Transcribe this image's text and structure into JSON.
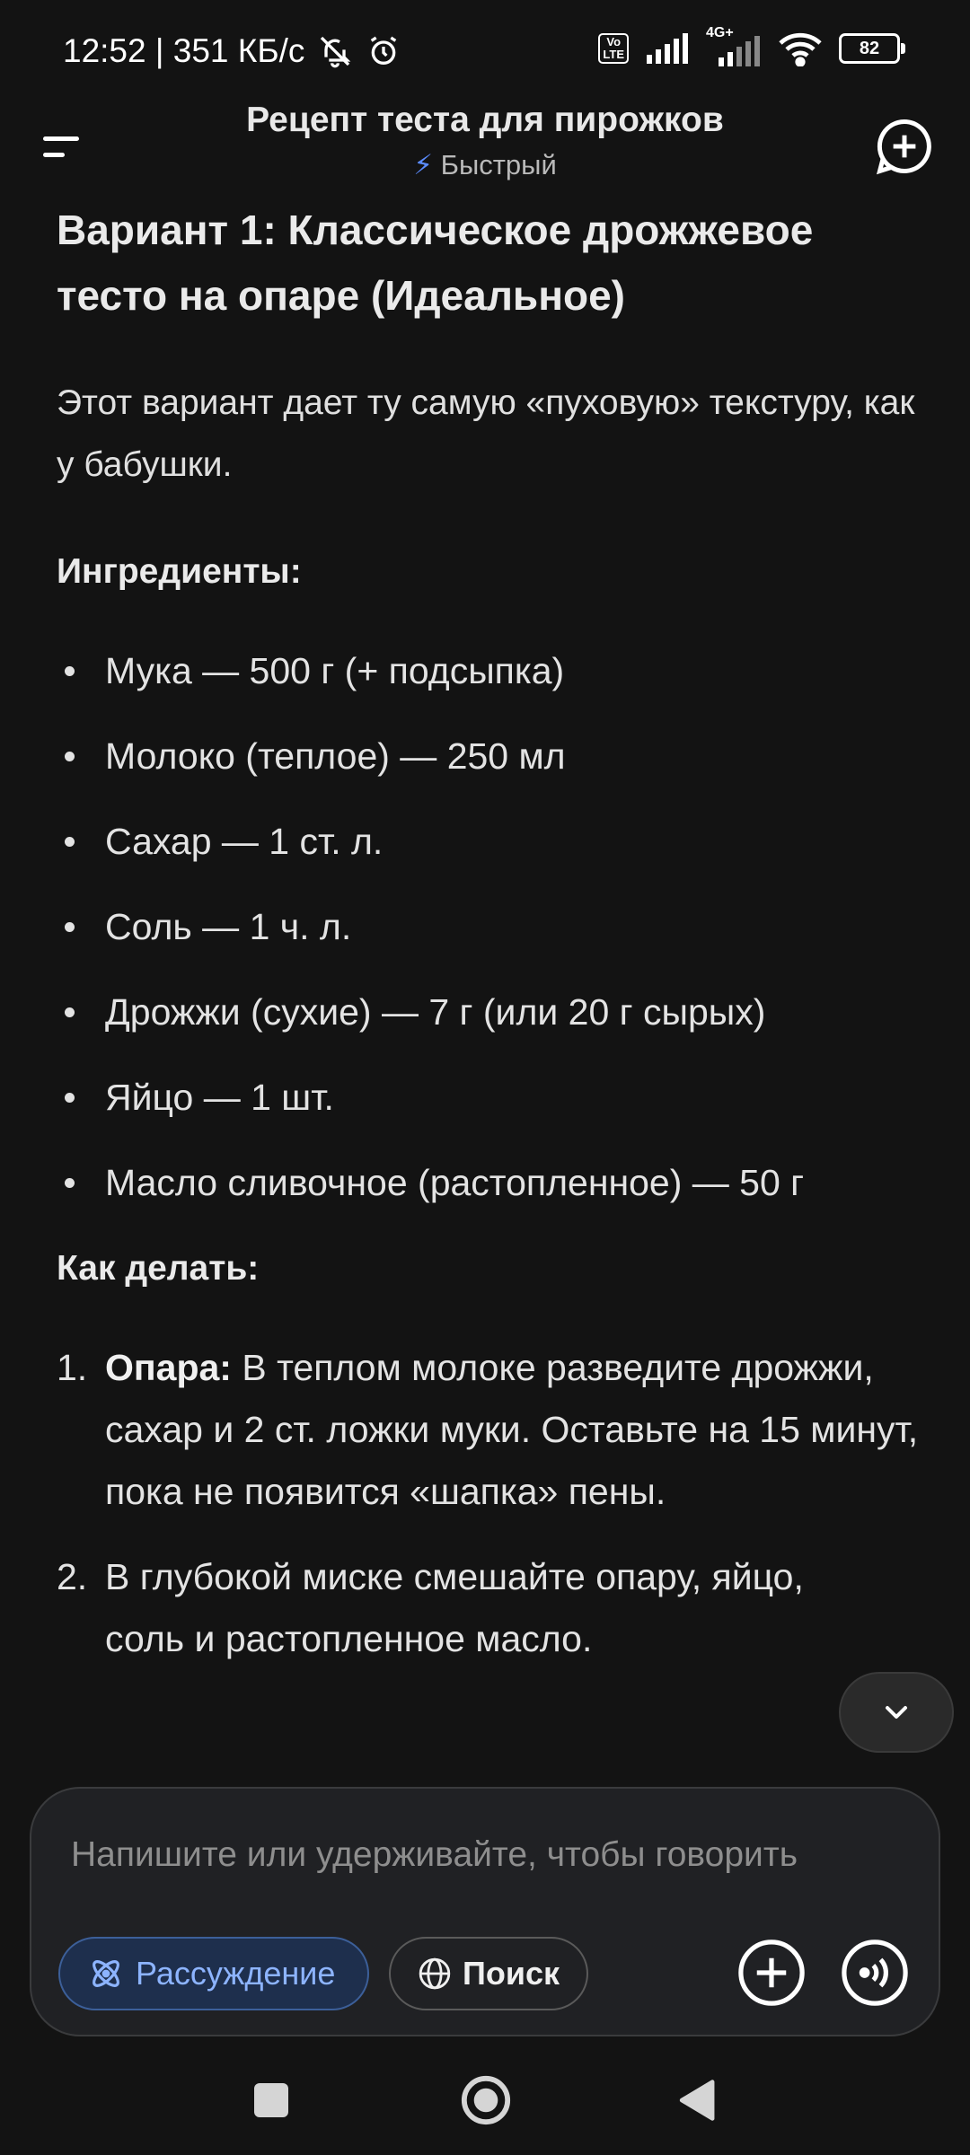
{
  "status_bar": {
    "time_speed": "12:52 | 351 КБ/с",
    "volte": "Vo LTE",
    "network": "4G+",
    "battery": "82"
  },
  "header": {
    "title": "Рецепт теста для пирожков",
    "mode": "Быстрый"
  },
  "content": {
    "heading": "Вариант 1: Классическое дрожжевое тесто на опаре (Идеальное)",
    "intro": "Этот вариант дает ту самую «пуховую» текстуру, как у бабушки.",
    "ingredients_title": "Ингредиенты:",
    "ingredients": [
      "Мука — 500 г (+ подсыпка)",
      "Молоко (теплое) — 250 мл",
      "Сахар — 1 ст. л.",
      "Соль — 1 ч. л.",
      "Дрожжи (сухие) — 7 г (или 20 г сырых)",
      "Яйцо — 1 шт.",
      "Масло сливочное (растопленное) — 50 г"
    ],
    "steps_title": "Как делать:",
    "steps": [
      {
        "num": "1.",
        "bold": "Опара:",
        "text": " В теплом молоке разведите дрожжи, сахар и 2 ст. ложки муки. Оставьте на 15 минут, пока не появится «шапка» пены."
      },
      {
        "num": "2.",
        "bold": "",
        "text": "В глубокой миске смешайте опару, яйцо, соль и растопленное масло."
      }
    ]
  },
  "composer": {
    "placeholder": "Напишите или удерживайте, чтобы говорить",
    "reasoning_label": "Рассуждение",
    "search_label": "Поиск"
  },
  "colors": {
    "background": "#131313",
    "accent_blue": "#8db4ff",
    "bolt": "#5b8cff"
  }
}
